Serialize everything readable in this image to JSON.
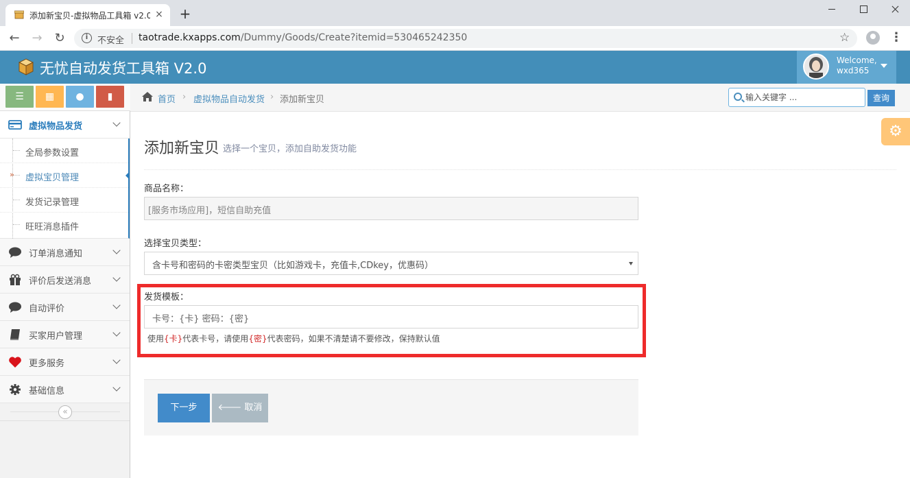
{
  "browser": {
    "tab_title": "添加新宝贝-虚拟物品工具箱 v2.0",
    "tab_close": "×",
    "new_tab": "+",
    "insecure_label": "不安全",
    "url_host": "taotrade.kxapps.com",
    "url_path": "/Dummy/Goods/Create?itemid=530465242350"
  },
  "header": {
    "title": "无忧自动发货工具箱 V2.0",
    "welcome": "Welcome,",
    "username": "wxd365"
  },
  "sidebar": {
    "shortcuts": [
      {
        "icon": "list-icon",
        "glyph": "☰",
        "color": "#87b87f"
      },
      {
        "icon": "calendar-icon",
        "glyph": "▦",
        "color": "#ffb752"
      },
      {
        "icon": "comment-icon",
        "glyph": "●",
        "color": "#6fb3e0"
      },
      {
        "icon": "book-icon",
        "glyph": "▮",
        "color": "#d15b47"
      }
    ],
    "sections": [
      {
        "label": "虚拟物品发货",
        "icon": "credit-card-icon"
      },
      {
        "label": "订单消息通知",
        "icon": "comment-icon"
      },
      {
        "label": "评价后发送消息",
        "icon": "gift-icon"
      },
      {
        "label": "自动评价",
        "icon": "comment-icon"
      },
      {
        "label": "买家用户管理",
        "icon": "book-icon"
      },
      {
        "label": "更多服务",
        "icon": "heart-icon"
      },
      {
        "label": "基础信息",
        "icon": "gear-icon"
      }
    ],
    "submenu": [
      {
        "label": "全局参数设置"
      },
      {
        "label": "虚拟宝贝管理",
        "current": true
      },
      {
        "label": "发货记录管理"
      },
      {
        "label": "旺旺消息插件"
      }
    ],
    "collapse_glyph": "«"
  },
  "breadcrumbs": {
    "home": "首页",
    "level2": "虚拟物品自动发货",
    "level3": "添加新宝贝",
    "separator": "›"
  },
  "search": {
    "placeholder": "输入关键字 ...",
    "button": "查询"
  },
  "page": {
    "title": "添加新宝贝",
    "subtitle": "选择一个宝贝，添加自助发货功能"
  },
  "form": {
    "product_name_label": "商品名称：",
    "product_name_value": "[服务市场应用]，短信自助充值",
    "type_label": "选择宝贝类型：",
    "type_selected": "含卡号和密码的卡密类型宝贝（比如游戏卡，充值卡,CDkey，优惠码）",
    "template_label": "发货模板：",
    "template_value": "卡号：{卡} 密码：{密}",
    "help_prefix": "使用",
    "help_card_token": "{卡}",
    "help_mid": "代表卡号，请使用",
    "help_pwd_token": "{密}",
    "help_suffix": "代表密码，如果不清楚请不要修改，保持默认值",
    "next_button": "下一步",
    "cancel_button": "取消"
  },
  "colors": {
    "header_bg": "#438eb9",
    "user_box_bg": "#62a8d1",
    "primary_button": "#428bca",
    "cancel_button": "#abbac3",
    "highlight_border": "#ee2b2b",
    "settings_tab": "#ffb44b"
  }
}
